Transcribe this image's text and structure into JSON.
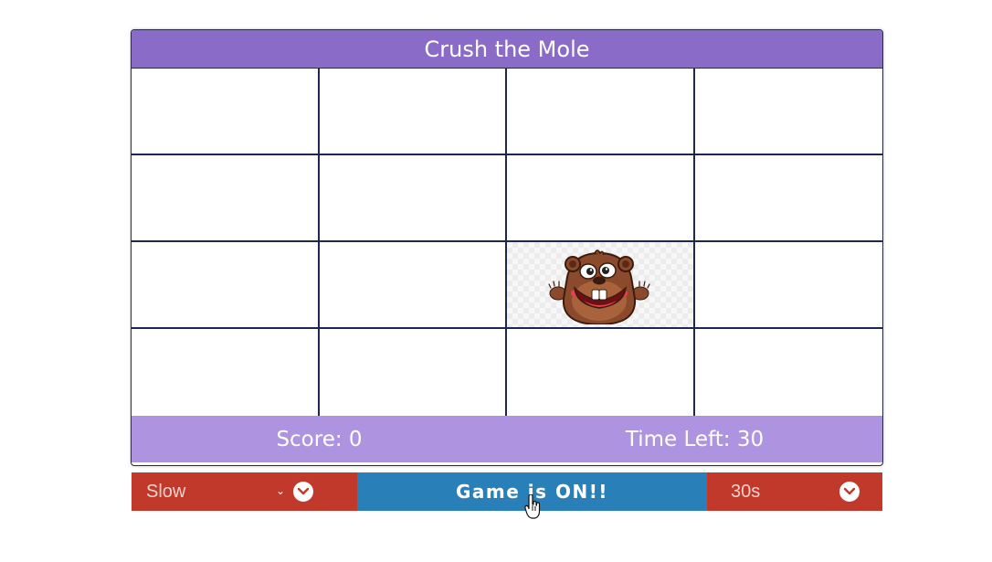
{
  "game": {
    "title": "Crush the Mole",
    "grid": {
      "rows": 4,
      "cols": 4,
      "mole_cell_index": 10
    },
    "score": "Score: 0",
    "time_left": "Time Left: 30"
  },
  "controls": {
    "speed_value": "Slow",
    "start_button_label": "Game is ON!!",
    "duration_value": "30s"
  },
  "colors": {
    "title_bar": "#8a6bc7",
    "status_bar": "#ae94e0",
    "select_bg": "#c0392b",
    "button_bg": "#2980b9",
    "grid_lines": "#1e2750"
  },
  "icons": {
    "mole": "mole-icon",
    "dropdown": "chevron-down-icon",
    "cursor": "hand-pointer-icon"
  }
}
